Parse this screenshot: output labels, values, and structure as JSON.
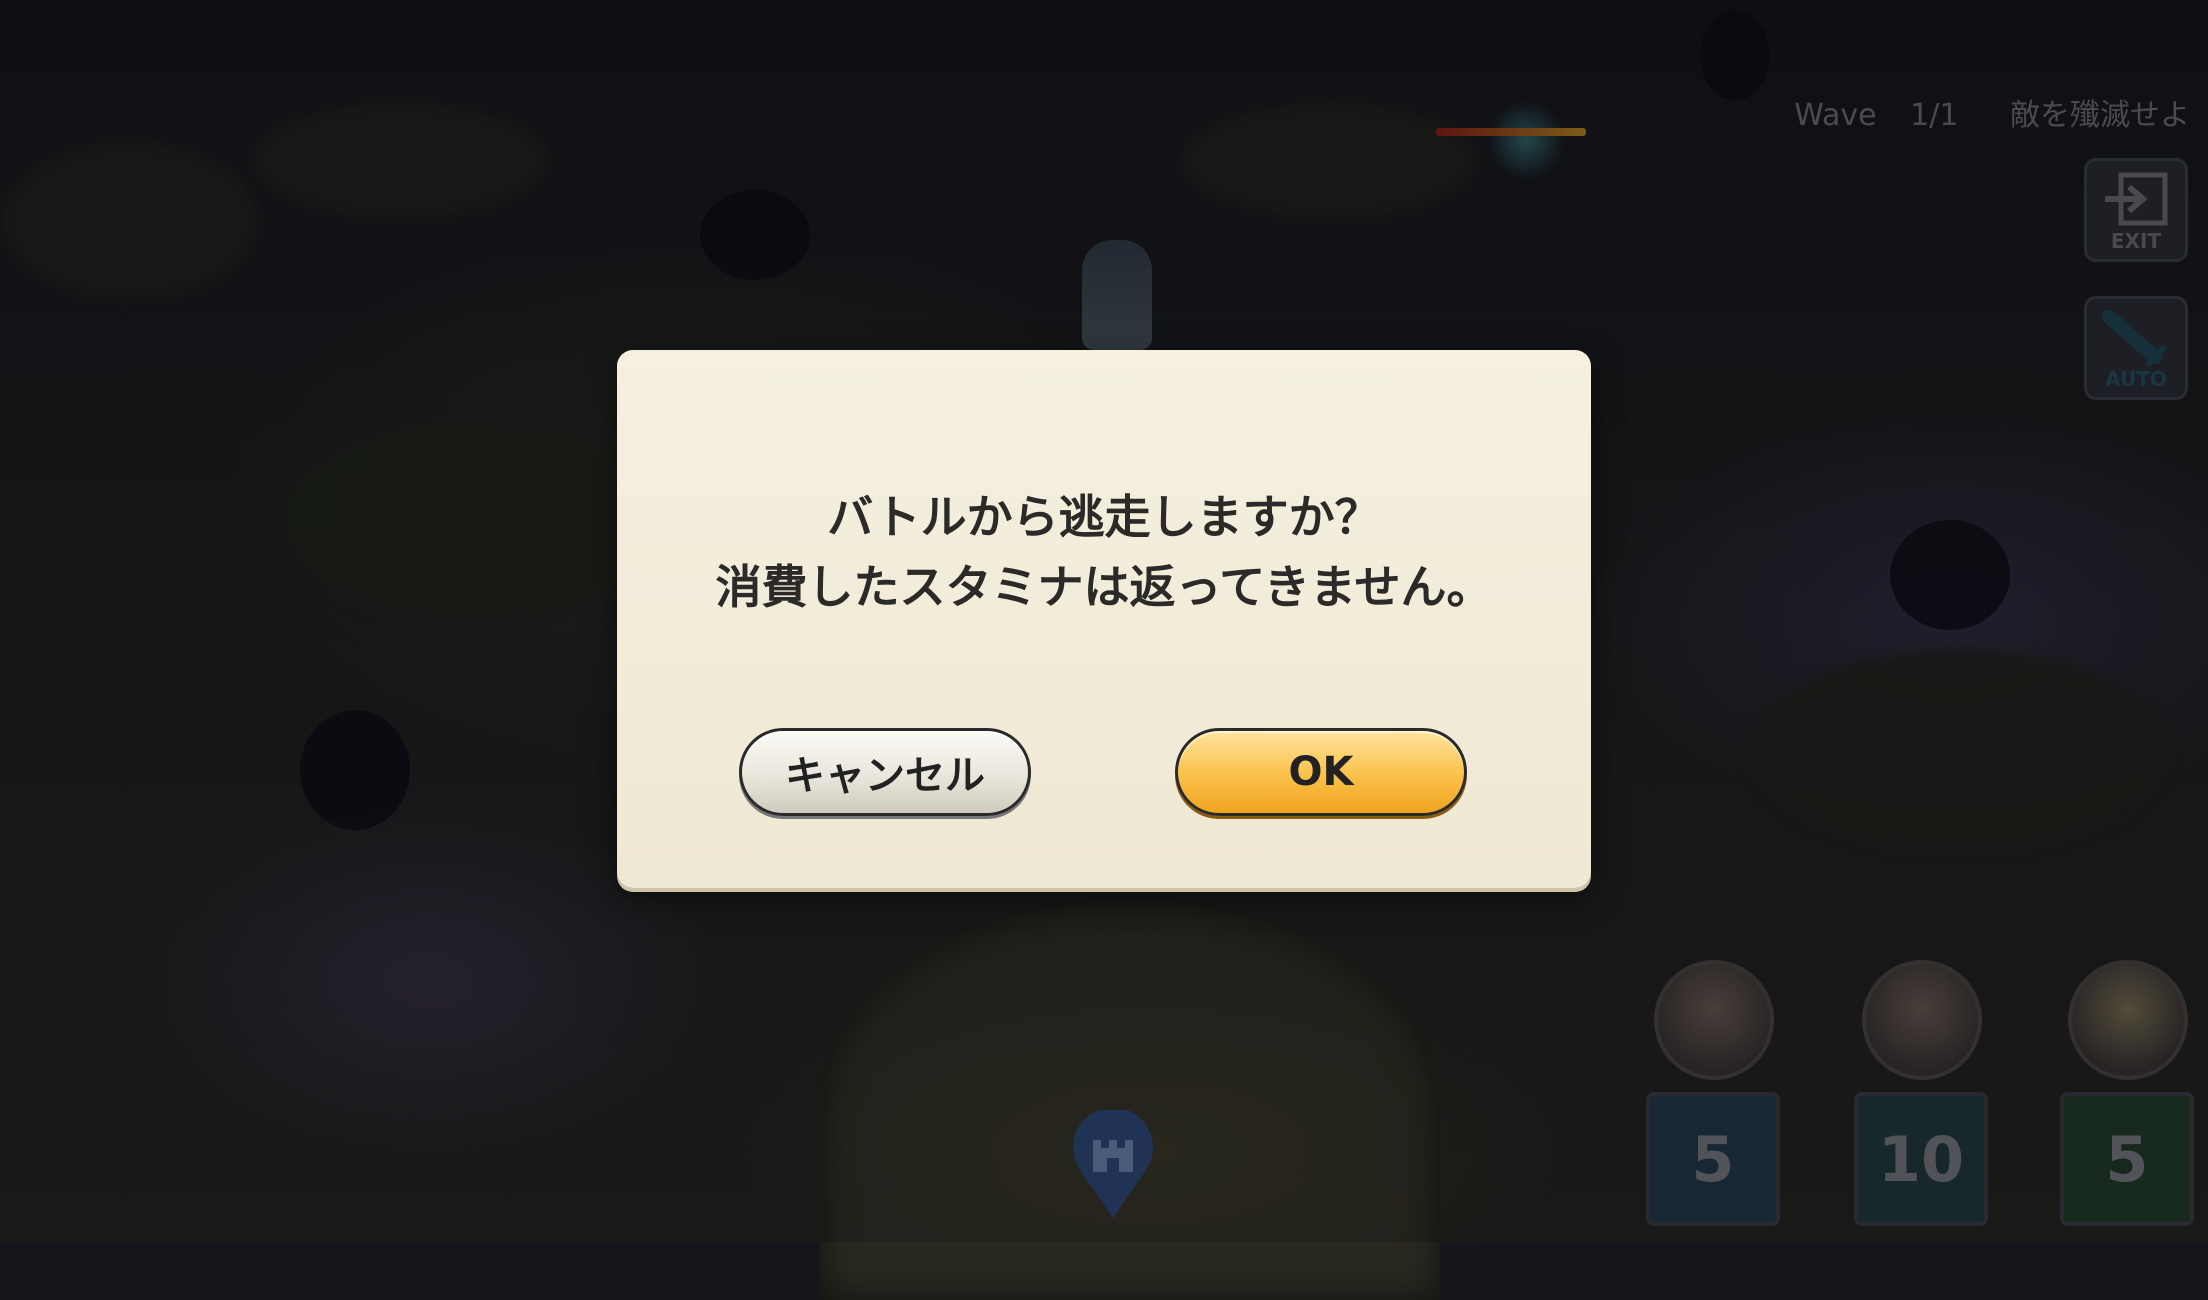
{
  "hud": {
    "wave_label": "Wave",
    "wave_count": "1/1",
    "objective": "敵を殲滅せよ",
    "exit_label": "EXIT",
    "auto_label": "AUTO"
  },
  "party": {
    "skills": [
      {
        "cost": "5",
        "color": "#1f3a48"
      },
      {
        "cost": "10",
        "color": "#1e3a36"
      },
      {
        "cost": "5",
        "color": "#1f3a24"
      }
    ]
  },
  "dialog": {
    "message_line1": "バトルから逃走しますか？",
    "message_line2": "消費したスタミナは返ってきません。",
    "cancel_label": "キャンセル",
    "ok_label": "OK"
  },
  "colors": {
    "dialog_bg": "#f5f0df",
    "ok_button": "#fbc44f",
    "cancel_button": "#e9e6dc"
  }
}
